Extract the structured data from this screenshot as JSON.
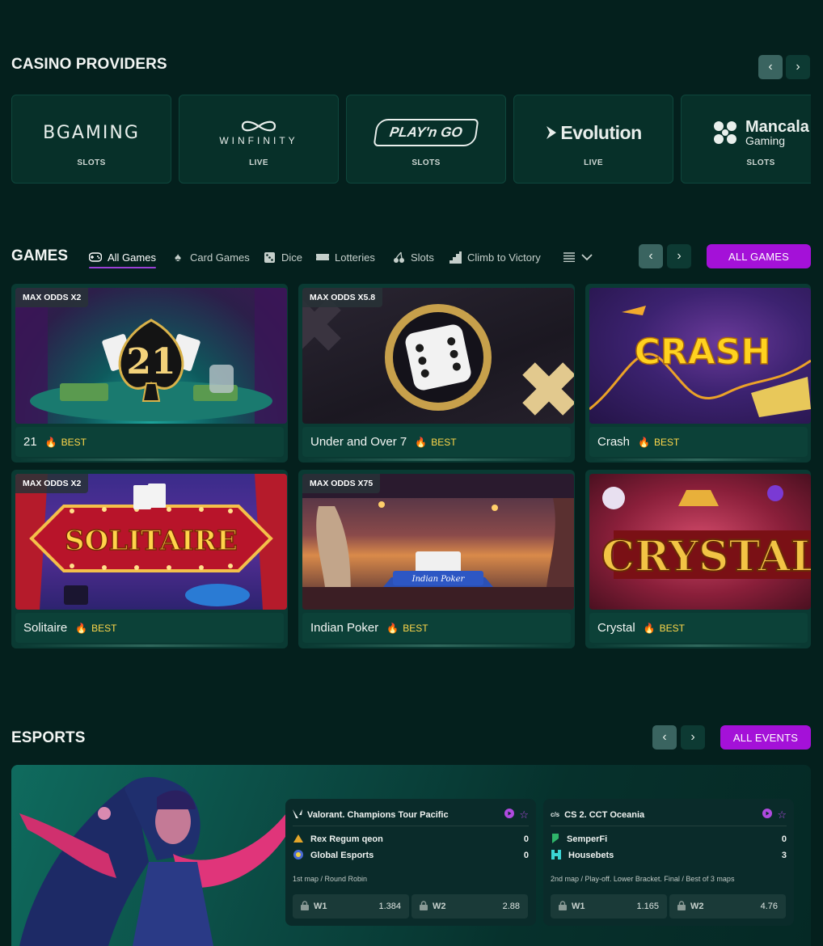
{
  "providers_section": {
    "title": "CASINO PROVIDERS",
    "items": [
      {
        "name": "BGAMING",
        "type": "SLOTS"
      },
      {
        "name": "WINFINITY",
        "type": "LIVE"
      },
      {
        "name": "PLAY'n GO",
        "type": "SLOTS"
      },
      {
        "name": "Evolution",
        "type": "LIVE"
      },
      {
        "name": "Mancala",
        "subname": "Gaming",
        "type": "SLOTS"
      }
    ]
  },
  "games_section": {
    "title": "GAMES",
    "all_button": "ALL GAMES",
    "tabs": [
      {
        "label": "All Games",
        "icon": "gamepad-icon",
        "active": true
      },
      {
        "label": "Card Games",
        "icon": "spade-icon"
      },
      {
        "label": "Dice",
        "icon": "dice-icon"
      },
      {
        "label": "Lotteries",
        "icon": "ticket-icon"
      },
      {
        "label": "Slots",
        "icon": "cherry-icon"
      },
      {
        "label": "Climb to Victory",
        "icon": "stairs-icon"
      }
    ],
    "cards": [
      {
        "name": "21",
        "badge": "BEST",
        "odds": "MAX ODDS X2"
      },
      {
        "name": "Under and Over 7",
        "badge": "BEST",
        "odds": "MAX ODDS X5.8"
      },
      {
        "name": "Crash",
        "badge": "BEST",
        "odds": ""
      },
      {
        "name": "Solitaire",
        "badge": "BEST",
        "odds": "MAX ODDS X2"
      },
      {
        "name": "Indian Poker",
        "badge": "BEST",
        "odds": "MAX ODDS X75"
      },
      {
        "name": "Crystal",
        "badge": "BEST",
        "odds": ""
      }
    ],
    "thumb_text": {
      "blackjack": "21",
      "crash": "CRASH",
      "solitaire": "SOLITAIRE",
      "indian_poker": "Indian Poker",
      "crystal": "CRYSTAL"
    }
  },
  "esports_section": {
    "title": "ESPORTS",
    "all_button": "ALL EVENTS",
    "matches": [
      {
        "league": "Valorant. Champions Tour Pacific",
        "team1": "Rex Regum qeon",
        "score1": "0",
        "team2": "Global Esports",
        "score2": "0",
        "info": "1st map / Round Robin",
        "w1_label": "W1",
        "w1": "1.384",
        "w2_label": "W2",
        "w2": "2.88"
      },
      {
        "league": "CS 2. CCT Oceania",
        "team1": "SemperFi",
        "score1": "0",
        "team2": "Housebets",
        "score2": "3",
        "info": "2nd map / Play-off. Lower Bracket. Final / Best of 3 maps",
        "w1_label": "W1",
        "w1": "1.165",
        "w2_label": "W2",
        "w2": "4.76"
      }
    ]
  },
  "colors": {
    "background": "#04201d",
    "accent": "#a411d8",
    "best": "#ffd84a"
  }
}
